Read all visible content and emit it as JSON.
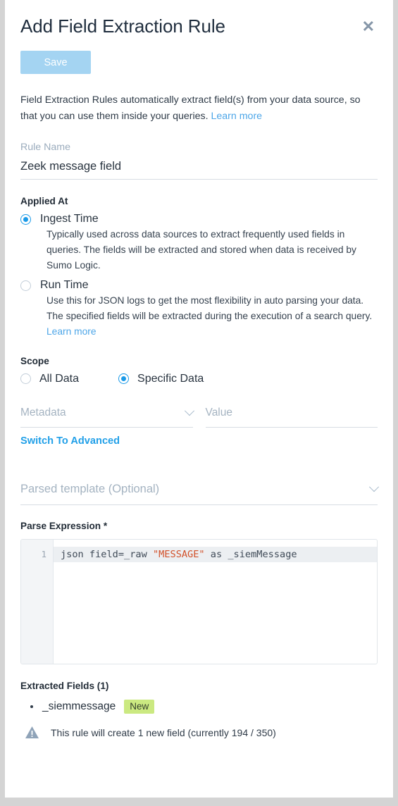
{
  "dialog": {
    "title": "Add Field Extraction Rule",
    "close_icon": "close-icon",
    "save_label": "Save"
  },
  "intro": {
    "text": "Field Extraction Rules automatically extract field(s) from your data source, so that you can use them inside your queries. ",
    "link_label": "Learn more"
  },
  "rule_name": {
    "label": "Rule Name",
    "value": "Zeek message field"
  },
  "applied_at": {
    "heading": "Applied At",
    "options": [
      {
        "label": "Ingest Time",
        "selected": true,
        "description": "Typically used across data sources to extract frequently used fields in queries. The fields will be extracted and stored when data is received by Sumo Logic."
      },
      {
        "label": "Run Time",
        "selected": false,
        "description": "Use this for JSON logs to get the most flexibility in auto parsing your data. The specified fields will be extracted during the execution of a search query. ",
        "link_label": "Learn more"
      }
    ]
  },
  "scope": {
    "heading": "Scope",
    "options": [
      {
        "label": "All Data",
        "selected": false
      },
      {
        "label": "Specific Data",
        "selected": true
      }
    ]
  },
  "metadata_field": {
    "placeholder": "Metadata",
    "value": "",
    "chevron_icon": "chevron-down-icon"
  },
  "value_field": {
    "placeholder": "Value",
    "value": ""
  },
  "switch_advanced": {
    "label": "Switch To Advanced"
  },
  "parsed_template": {
    "placeholder": "Parsed template (Optional)",
    "value": "",
    "chevron_icon": "chevron-down-icon"
  },
  "parse_expression": {
    "heading": "Parse Expression *",
    "line_number": "1",
    "code_prefix": "json field=_raw ",
    "code_string": "\"MESSAGE\"",
    "code_suffix": " as _siemMessage"
  },
  "extracted_fields": {
    "heading": "Extracted Fields (1)",
    "items": [
      {
        "name": "_siemmessage",
        "badge": "New"
      }
    ],
    "warning_icon": "warning-triangle-icon",
    "warning_text": "This rule will create 1 new field (currently 194 / 350)"
  },
  "colors": {
    "accent_link": "#4da6e8",
    "accent_strong_link": "#22a0e8",
    "radio_selected": "#1a9ae8",
    "save_disabled_bg": "#a4d4f2",
    "badge_new_bg": "#cbe981",
    "code_string": "#d2512a",
    "panel_bg": "#ffffff",
    "page_bg": "#d4d4d4"
  }
}
